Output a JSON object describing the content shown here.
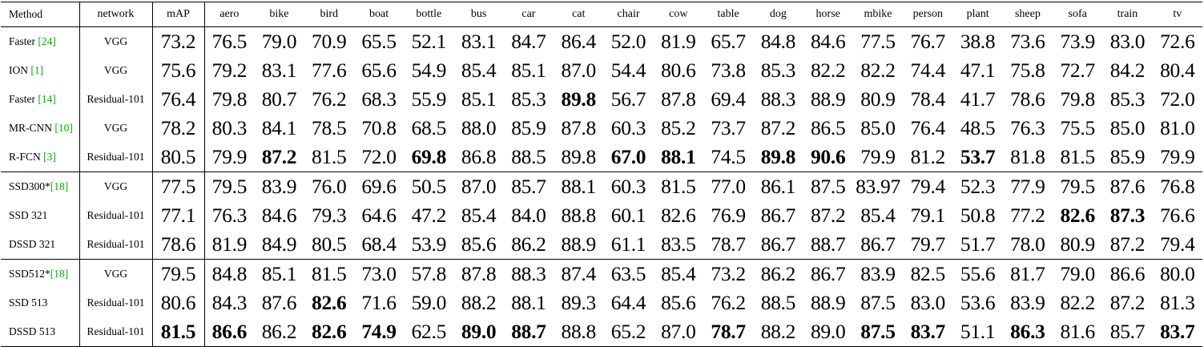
{
  "table": {
    "headers": [
      "Method",
      "network",
      "mAP",
      "aero",
      "bike",
      "bird",
      "boat",
      "bottle",
      "bus",
      "car",
      "cat",
      "chair",
      "cow",
      "table",
      "dog",
      "horse",
      "mbike",
      "person",
      "plant",
      "sheep",
      "sofa",
      "train",
      "tv"
    ],
    "rows": [
      {
        "method": "Faster",
        "ref": "[24]",
        "network": "VGG",
        "values": [
          "73.2",
          "76.5",
          "79.0",
          "70.9",
          "65.5",
          "52.1",
          "83.1",
          "84.7",
          "86.4",
          "52.0",
          "81.9",
          "65.7",
          "84.8",
          "84.6",
          "77.5",
          "76.7",
          "38.8",
          "73.6",
          "73.9",
          "83.0",
          "72.6"
        ],
        "bold": []
      },
      {
        "method": "ION",
        "ref": "[1]",
        "network": "VGG",
        "values": [
          "75.6",
          "79.2",
          "83.1",
          "77.6",
          "65.6",
          "54.9",
          "85.4",
          "85.1",
          "87.0",
          "54.4",
          "80.6",
          "73.8",
          "85.3",
          "82.2",
          "82.2",
          "74.4",
          "47.1",
          "75.8",
          "72.7",
          "84.2",
          "80.4"
        ],
        "bold": []
      },
      {
        "method": "Faster",
        "ref": "[14]",
        "network": "Residual-101",
        "values": [
          "76.4",
          "79.8",
          "80.7",
          "76.2",
          "68.3",
          "55.9",
          "85.1",
          "85.3",
          "89.8",
          "56.7",
          "87.8",
          "69.4",
          "88.3",
          "88.9",
          "80.9",
          "78.4",
          "41.7",
          "78.6",
          "79.8",
          "85.3",
          "72.0"
        ],
        "bold": [
          8
        ]
      },
      {
        "method": "MR-CNN",
        "ref": "[10]",
        "network": "VGG",
        "values": [
          "78.2",
          "80.3",
          "84.1",
          "78.5",
          "70.8",
          "68.5",
          "88.0",
          "85.9",
          "87.8",
          "60.3",
          "85.2",
          "73.7",
          "87.2",
          "86.5",
          "85.0",
          "76.4",
          "48.5",
          "76.3",
          "75.5",
          "85.0",
          "81.0"
        ],
        "bold": []
      },
      {
        "method": "R-FCN",
        "ref": "[3]",
        "network": "Residual-101",
        "values": [
          "80.5",
          "79.9",
          "87.2",
          "81.5",
          "72.0",
          "69.8",
          "86.8",
          "88.5",
          "89.8",
          "67.0",
          "88.1",
          "74.5",
          "89.8",
          "90.6",
          "79.9",
          "81.2",
          "53.7",
          "81.8",
          "81.5",
          "85.9",
          "79.9"
        ],
        "bold": [
          2,
          5,
          9,
          10,
          12,
          13,
          16
        ]
      },
      {
        "method": "SSD300*",
        "ref": "[18]",
        "network": "VGG",
        "values": [
          "77.5",
          "79.5",
          "83.9",
          "76.0",
          "69.6",
          "50.5",
          "87.0",
          "85.7",
          "88.1",
          "60.3",
          "81.5",
          "77.0",
          "86.1",
          "87.5",
          "83.97",
          "79.4",
          "52.3",
          "77.9",
          "79.5",
          "87.6",
          "76.8"
        ],
        "bold": [],
        "group_start": true
      },
      {
        "method": "SSD 321",
        "ref": "",
        "network": "Residual-101",
        "values": [
          "77.1",
          "76.3",
          "84.6",
          "79.3",
          "64.6",
          "47.2",
          "85.4",
          "84.0",
          "88.8",
          "60.1",
          "82.6",
          "76.9",
          "86.7",
          "87.2",
          "85.4",
          "79.1",
          "50.8",
          "77.2",
          "82.6",
          "87.3",
          "76.6"
        ],
        "bold": [
          18,
          19
        ]
      },
      {
        "method": "DSSD 321",
        "ref": "",
        "network": "Residual-101",
        "values": [
          "78.6",
          "81.9",
          "84.9",
          "80.5",
          "68.4",
          "53.9",
          "85.6",
          "86.2",
          "88.9",
          "61.1",
          "83.5",
          "78.7",
          "86.7",
          "88.7",
          "86.7",
          "79.7",
          "51.7",
          "78.0",
          "80.9",
          "87.2",
          "79.4"
        ],
        "bold": []
      },
      {
        "method": "SSD512*",
        "ref": "[18]",
        "network": "VGG",
        "values": [
          "79.5",
          "84.8",
          "85.1",
          "81.5",
          "73.0",
          "57.8",
          "87.8",
          "88.3",
          "87.4",
          "63.5",
          "85.4",
          "73.2",
          "86.2",
          "86.7",
          "83.9",
          "82.5",
          "55.6",
          "81.7",
          "79.0",
          "86.6",
          "80.0"
        ],
        "bold": [],
        "group_start": true
      },
      {
        "method": "SSD 513",
        "ref": "",
        "network": "Residual-101",
        "values": [
          "80.6",
          "84.3",
          "87.6",
          "82.6",
          "71.6",
          "59.0",
          "88.2",
          "88.1",
          "89.3",
          "64.4",
          "85.6",
          "76.2",
          "88.5",
          "88.9",
          "87.5",
          "83.0",
          "53.6",
          "83.9",
          "82.2",
          "87.2",
          "81.3"
        ],
        "bold": [
          3
        ]
      },
      {
        "method": "DSSD 513",
        "ref": "",
        "network": "Residual-101",
        "values": [
          "81.5",
          "86.6",
          "86.2",
          "82.6",
          "74.9",
          "62.5",
          "89.0",
          "88.7",
          "88.8",
          "65.2",
          "87.0",
          "78.7",
          "88.2",
          "89.0",
          "87.5",
          "83.7",
          "51.1",
          "86.3",
          "81.6",
          "85.7",
          "83.7"
        ],
        "bold": [
          0,
          1,
          3,
          4,
          6,
          7,
          11,
          14,
          15,
          17,
          20
        ]
      }
    ]
  },
  "colors": {
    "text": "#000000",
    "reference": "#00b000",
    "background": "#ffffff"
  }
}
